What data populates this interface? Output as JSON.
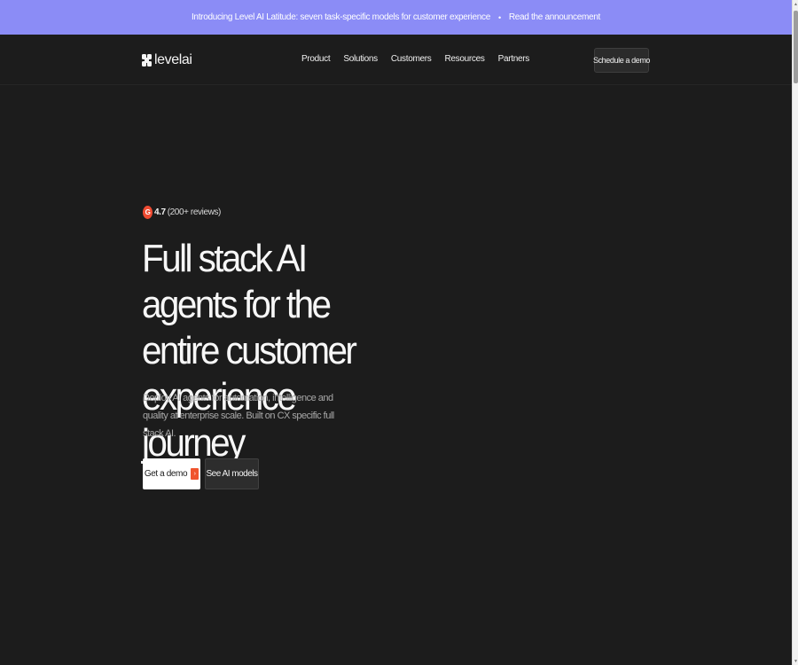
{
  "announcement": {
    "text": "Introducing Level AI Latitude: seven task-specific models for customer experience",
    "separator": "•",
    "link_label": "Read the announcement"
  },
  "nav": {
    "logo_text": "levelai",
    "links": [
      "Product",
      "Solutions",
      "Customers",
      "Resources",
      "Partners"
    ],
    "cta_label": "Schedule a demo"
  },
  "hero": {
    "rating_badge": "G",
    "rating_score": "4.7",
    "rating_reviews": "(200+ reviews)",
    "headline": "Full stack AI agents for the entire customer experience journey",
    "subheadline": "Deploy AI agents for automation, intelligence and quality at enterprise scale. Built on CX specific full stack AI.",
    "primary_cta": "Get a demo",
    "primary_cta_arrow": "›",
    "secondary_cta": "See AI models"
  },
  "scrollbar": {
    "up_arrow": "▲",
    "down_arrow": "▼"
  },
  "colors": {
    "background": "#1c1c1c",
    "announcement_bg": "#8b8cf6",
    "accent_orange": "#f0542d",
    "g2_red": "#ef4b32"
  }
}
